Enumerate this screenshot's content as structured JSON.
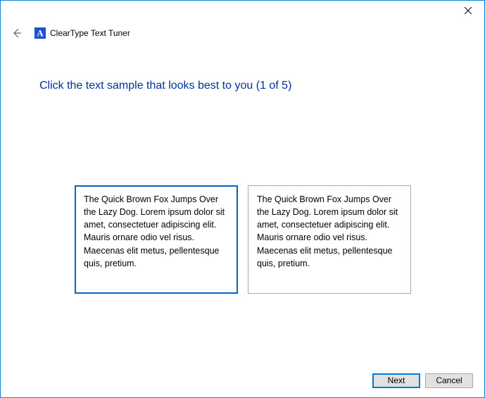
{
  "window": {
    "app_title": "ClearType Text Tuner"
  },
  "main": {
    "heading": "Click the text sample that looks best to you (1 of 5)",
    "samples": [
      {
        "text": "The Quick Brown Fox Jumps Over the Lazy Dog. Lorem ipsum dolor sit amet, consectetuer adipiscing elit. Mauris ornare odio vel risus. Maecenas elit metus, pellentesque quis, pretium.",
        "selected": true
      },
      {
        "text": "The Quick Brown Fox Jumps Over the Lazy Dog. Lorem ipsum dolor sit amet, consectetuer adipiscing elit. Mauris ornare odio vel risus. Maecenas elit metus, pellentesque quis, pretium.",
        "selected": false
      }
    ]
  },
  "footer": {
    "next_label": "Next",
    "cancel_label": "Cancel"
  }
}
